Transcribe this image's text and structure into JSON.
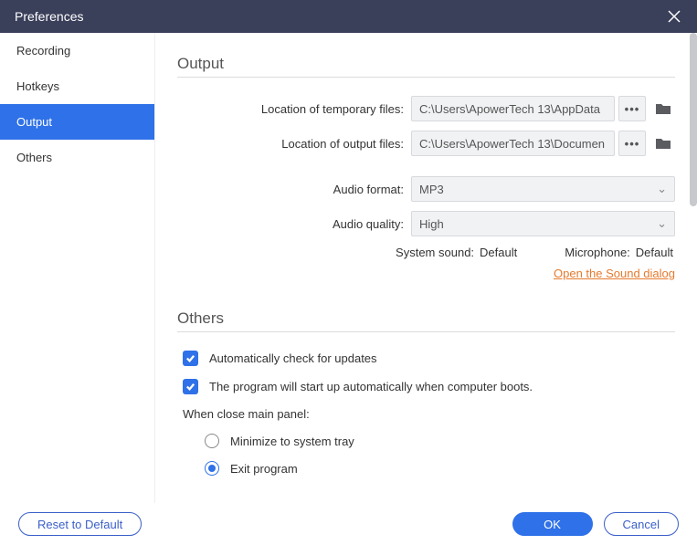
{
  "window": {
    "title": "Preferences"
  },
  "sidebar": {
    "items": [
      {
        "label": "Recording"
      },
      {
        "label": "Hotkeys"
      },
      {
        "label": "Output"
      },
      {
        "label": "Others"
      }
    ],
    "activeIndex": 2
  },
  "output": {
    "sectionTitle": "Output",
    "tempLabel": "Location of temporary files:",
    "tempPath": "C:\\Users\\ApowerTech 13\\AppData",
    "outLabel": "Location of output files:",
    "outPath": "C:\\Users\\ApowerTech 13\\Documen",
    "dots": "•••",
    "audioFormatLabel": "Audio format:",
    "audioFormatValue": "MP3",
    "audioQualityLabel": "Audio quality:",
    "audioQualityValue": "High",
    "systemSoundLabel": "System sound:",
    "systemSoundValue": "Default",
    "microphoneLabel": "Microphone:",
    "microphoneValue": "Default",
    "soundDialogLink": "Open the Sound dialog"
  },
  "others": {
    "sectionTitle": "Others",
    "check1": "Automatically check for updates",
    "check2": "The program will start up automatically when computer boots.",
    "closeLabel": "When close main panel:",
    "radio1": "Minimize to system tray",
    "radio2": "Exit program",
    "selectedRadio": 2
  },
  "footer": {
    "reset": "Reset to Default",
    "ok": "OK",
    "cancel": "Cancel"
  }
}
